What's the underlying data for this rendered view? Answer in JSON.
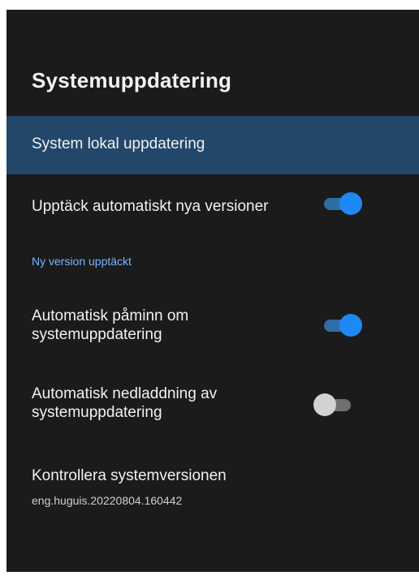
{
  "header": {
    "title": "Systemuppdatering"
  },
  "items": {
    "local_update": {
      "label": "System lokal uppdatering"
    },
    "auto_detect": {
      "label": "Upptäck automatiskt nya versioner",
      "enabled": true
    },
    "new_version_detected": {
      "label": "Ny version upptäckt"
    },
    "auto_reminder": {
      "label_line1": "Automatisk påminn om",
      "label_line2": "systemuppdatering",
      "enabled": true
    },
    "auto_download": {
      "label_line1": "Automatisk nedladdning av",
      "label_line2": "systemuppdatering",
      "enabled": false
    },
    "check_version": {
      "label": "Kontrollera systemversionen",
      "version": "eng.huguis.20220804.160442"
    }
  },
  "colors": {
    "background": "#1b1b1b",
    "selected_row": "#23476a",
    "accent": "#1e88f5",
    "section_heading": "#74b6ff"
  }
}
